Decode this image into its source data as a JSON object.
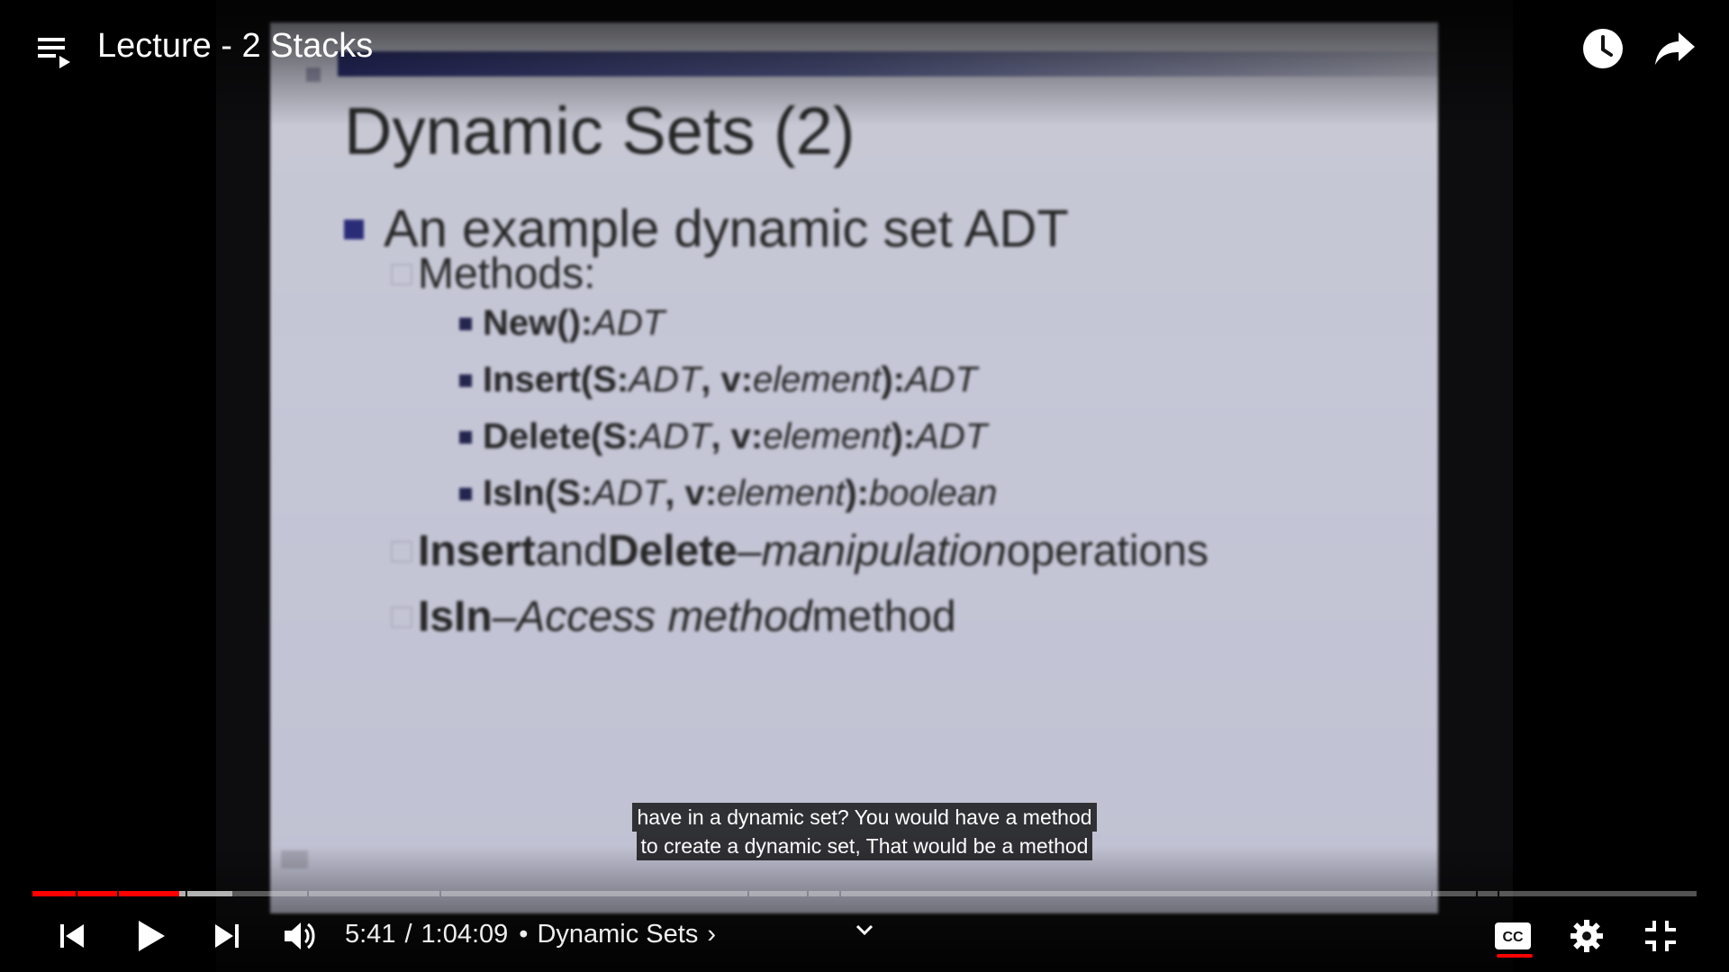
{
  "player": {
    "title": "Lecture - 2 Stacks",
    "accent_color": "#ff0000"
  },
  "header_icons": [
    "playlist-icon",
    "watch-later-clock-icon",
    "share-arrow-icon"
  ],
  "slide": {
    "title": "Dynamic Sets (2)",
    "bullet1": "An example dynamic set ADT",
    "methods_label": "Methods:",
    "methods": [
      {
        "name": "New():",
        "sig": "ADT",
        "rest": ""
      },
      {
        "name": "Insert(S:",
        "sig": "ADT",
        "rest": ", v:"
      },
      {
        "name": "Delete(S:",
        "sig": "ADT",
        "rest": ", v:"
      },
      {
        "name": "IsIn(S:",
        "sig": "ADT",
        "rest": ", v:"
      }
    ],
    "method_lines": {
      "new": {
        "a": "New():",
        "b": "ADT"
      },
      "insert": {
        "a": "Insert(S:",
        "b": "ADT",
        "c": ", v:",
        "d": "element",
        "e": "):",
        "f": "ADT"
      },
      "delete": {
        "a": "Delete(S:",
        "b": "ADT",
        "c": ", v:",
        "d": "element",
        "e": "):",
        "f": "ADT"
      },
      "isin": {
        "a": "IsIn(S:",
        "b": "ADT",
        "c": ", v:",
        "d": "element",
        "e": "):",
        "f": "boolean"
      }
    },
    "line_insert_delete": {
      "a": "Insert",
      "b": " and ",
      "c": "Delete",
      "d": " – ",
      "e": "manipulation",
      "f": " operations"
    },
    "line_isin": {
      "a": "IsIn",
      "b": " – ",
      "c": "Access method",
      "d": " method"
    }
  },
  "captions": [
    "have in a dynamic set? You would have a method",
    "to create a dynamic set, That would be a method"
  ],
  "controls": {
    "current_time": "5:41",
    "separator": "/",
    "duration": "1:04:09",
    "chapter_bullet": "•",
    "chapter": "Dynamic Sets",
    "chapter_arrow": "›",
    "buttons": [
      "previous",
      "play",
      "next",
      "volume",
      "captions",
      "settings",
      "exit-fullscreen"
    ],
    "captions_on": true
  },
  "progress": {
    "played_fraction": 0.088,
    "buffered_fraction": 0.12
  }
}
